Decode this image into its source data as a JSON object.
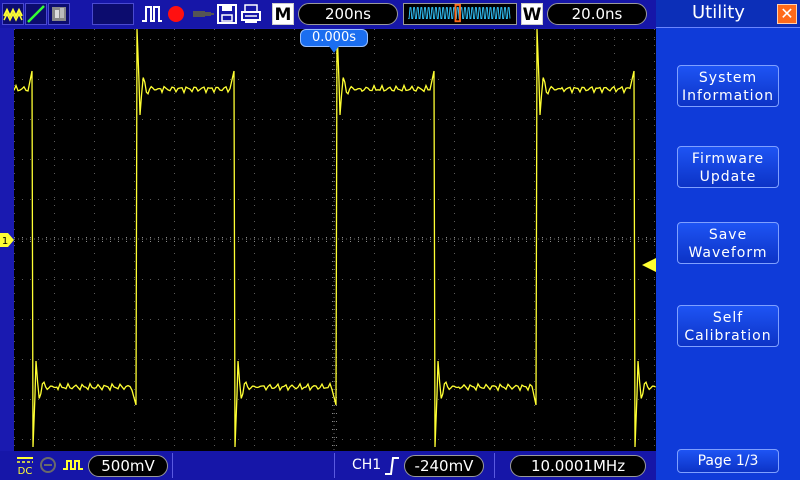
{
  "topbar": {
    "icons": [
      "ch1-wave-icon",
      "ch2-line-icon",
      "math-icon",
      "pulse-icon",
      "record-dot-icon",
      "usb-plug-icon",
      "floppy-save-icon",
      "printer-icon"
    ],
    "timebase_label": "M",
    "timebase_value": "200ns",
    "window_label": "W",
    "window_value": "20.0ns"
  },
  "trigger_position": "0.000s",
  "panel": {
    "title": "Utility",
    "buttons": [
      {
        "line1": "System",
        "line2": "Information"
      },
      {
        "line1": "Firmware",
        "line2": "Update"
      },
      {
        "line1": "Save",
        "line2": "Waveform"
      },
      {
        "line1": "Self",
        "line2": "Calibration"
      }
    ],
    "page": "Page 1/3"
  },
  "bottombar": {
    "coupling": "DC",
    "volts_div": "500mV",
    "trigger_source": "CH1",
    "trigger_level": "-240mV",
    "frequency": "10.0001MHz"
  },
  "colors": {
    "trace": "#ffff33",
    "panel": "#0f3bd9",
    "bar": "#1616a8",
    "accent_orange": "#ff6a1a"
  },
  "channel_marker": "1"
}
